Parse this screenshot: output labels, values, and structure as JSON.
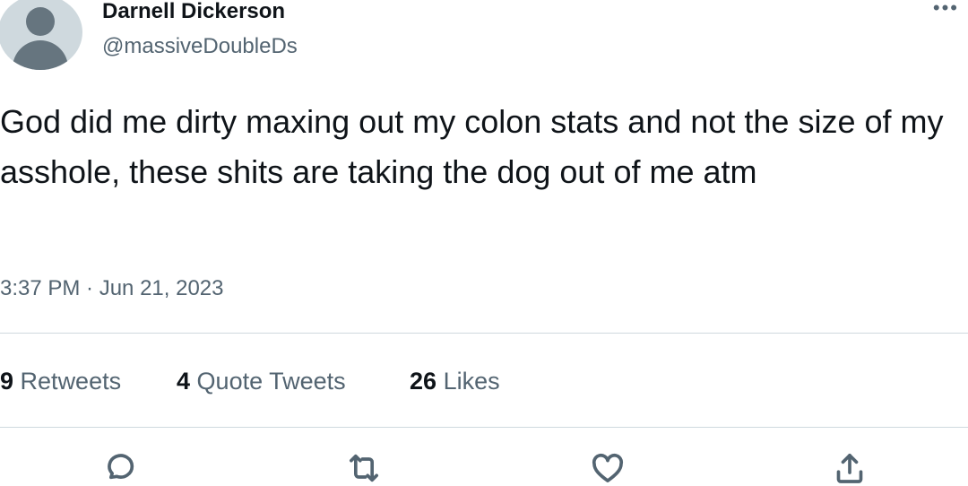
{
  "author": {
    "display_name": "Darnell Dickerson",
    "handle": "@massiveDoubleDs",
    "avatar_icon": "default-avatar-icon"
  },
  "more_icon": "ellipsis-icon",
  "tweet": {
    "text": "God did me dirty maxing out my colon stats and not the size of my asshole, these shits are taking the dog out of me atm",
    "timestamp": "3:37 PM · Jun 21, 2023"
  },
  "stats": {
    "retweets": {
      "count": "9",
      "label": "Retweets"
    },
    "quote_tweets": {
      "count": "4",
      "label": "Quote Tweets"
    },
    "likes": {
      "count": "26",
      "label": "Likes"
    }
  },
  "actions": [
    "reply-icon",
    "retweet-icon",
    "like-icon",
    "share-icon"
  ],
  "colors": {
    "text": "#0f1419",
    "secondary": "#536471",
    "divider": "#cfd9de"
  }
}
